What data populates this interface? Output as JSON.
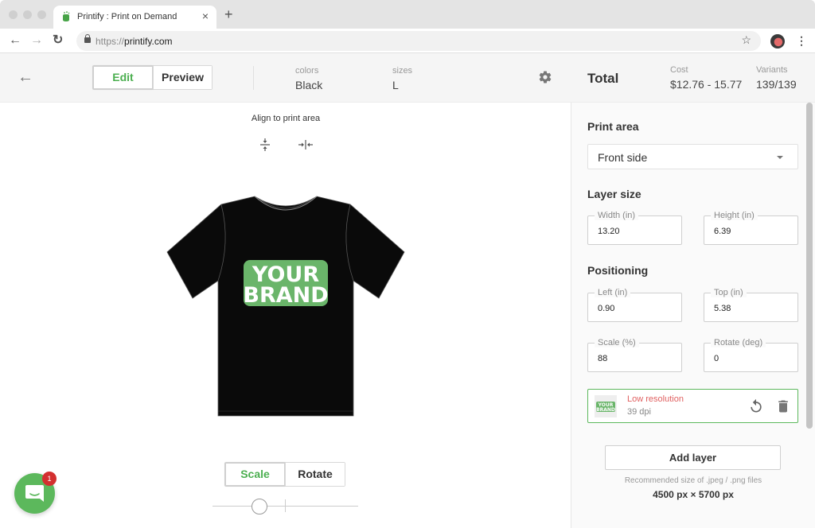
{
  "browser": {
    "tab_title": "Printify : Print on Demand",
    "url_scheme": "https://",
    "url_host": "printify.com",
    "icons": {
      "favicon": "printify-logo-icon",
      "close_tab": "close-icon",
      "new_tab": "plus-icon",
      "back": "arrow-left-icon",
      "forward": "arrow-right-icon",
      "reload": "reload-icon",
      "lock": "lock-icon",
      "bookmark": "star-icon",
      "profile": "avatar",
      "menu": "more-vertical-icon"
    },
    "glyphs": {
      "close": "×",
      "plus": "+",
      "back": "←",
      "forward": "→",
      "reload": "↻",
      "star": "☆",
      "menu": "⋮"
    }
  },
  "header": {
    "back_glyph": "←",
    "mode_tabs": [
      {
        "label": "Edit",
        "active": true
      },
      {
        "label": "Preview",
        "active": false
      }
    ],
    "colors_label": "colors",
    "colors_value": "Black",
    "sizes_label": "sizes",
    "sizes_value": "L",
    "settings_icon": "gear-icon"
  },
  "canvas": {
    "align_label": "Align to print area",
    "align_icons": [
      "align-vertical-center-icon",
      "align-horizontal-center-icon"
    ],
    "product": {
      "type": "t-shirt",
      "color": "#0a0a0a",
      "print_text_line1": "YOUR",
      "print_text_line2": "BRAND",
      "print_color": "#6ab56a"
    },
    "transform_tabs": [
      {
        "label": "Scale",
        "active": true
      },
      {
        "label": "Rotate",
        "active": false
      }
    ],
    "slider_value_fraction": 0.32,
    "chat": {
      "icon": "chat-icon",
      "badge_count": "1"
    }
  },
  "panel": {
    "total_label": "Total",
    "cost_label": "Cost",
    "cost_value": "$12.76 - 15.77",
    "variants_label": "Variants",
    "variants_value": "139/139",
    "print_area": {
      "title": "Print area",
      "selected": "Front side"
    },
    "layer_size": {
      "title": "Layer size",
      "width": {
        "label": "Width (in)",
        "value": "13.20"
      },
      "height": {
        "label": "Height (in)",
        "value": "6.39"
      }
    },
    "positioning": {
      "title": "Positioning",
      "left": {
        "label": "Left (in)",
        "value": "0.90"
      },
      "top": {
        "label": "Top (in)",
        "value": "5.38"
      },
      "scale": {
        "label": "Scale (%)",
        "value": "88"
      },
      "rotate": {
        "label": "Rotate (deg)",
        "value": "0"
      }
    },
    "layer": {
      "thumb_text1": "YOUR",
      "thumb_text2": "BRAND",
      "status": "Low resolution",
      "dpi": "39 dpi"
    },
    "add_layer_label": "Add layer",
    "recommend_note": "Recommended size of .jpeg / .png files",
    "recommend_size": "4500 px × 5700 px"
  },
  "colors": {
    "accent": "#4caf50",
    "chat": "#5cb85c",
    "badge": "#d32f2f",
    "warning_text": "#e06060"
  }
}
